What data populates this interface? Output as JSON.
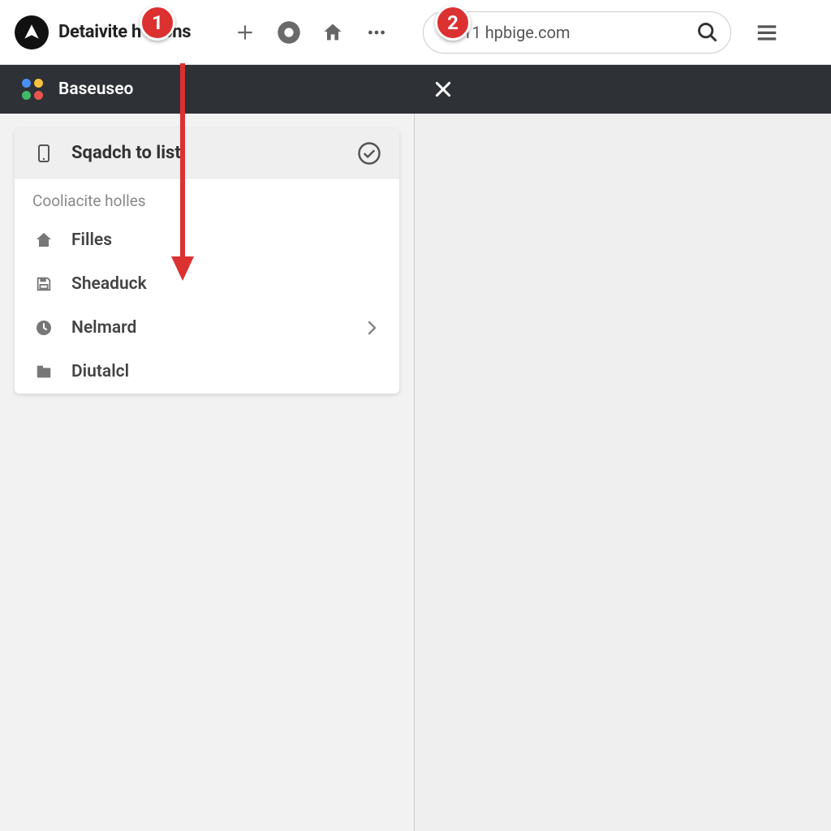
{
  "toolbar": {
    "app_title": "Detaivite h   rtions",
    "address_text": "11 hpbige.com"
  },
  "dark_strip": {
    "brand": "Baseuseo"
  },
  "card": {
    "header_title": "Sqadch to list",
    "section_label": "Cooliacite holles",
    "items": [
      {
        "label": "Filles"
      },
      {
        "label": "Sheaduck"
      },
      {
        "label": "Nelmard"
      },
      {
        "label": "Diutalcl"
      }
    ]
  },
  "steps": {
    "one": "1",
    "two": "2"
  }
}
